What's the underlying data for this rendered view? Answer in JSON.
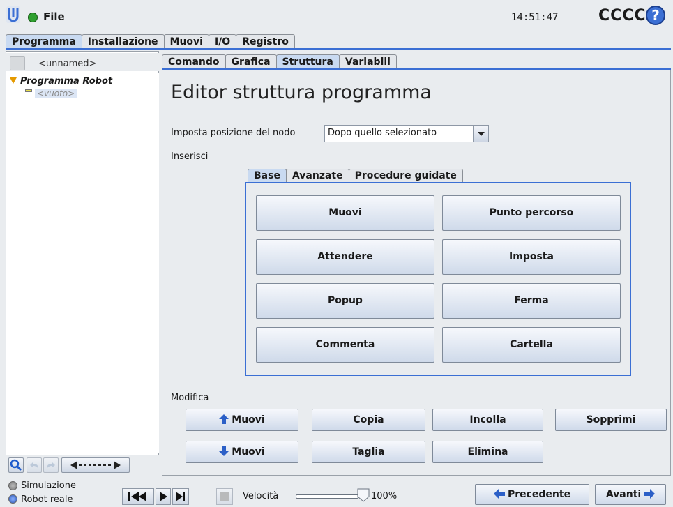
{
  "header": {
    "file_label": "File",
    "clock": "14:51:47",
    "robot_name": "CCCC",
    "help_glyph": "?"
  },
  "main_tabs": [
    {
      "label": "Programma",
      "active": true
    },
    {
      "label": "Installazione",
      "active": false
    },
    {
      "label": "Muovi",
      "active": false
    },
    {
      "label": "I/O",
      "active": false
    },
    {
      "label": "Registro",
      "active": false
    }
  ],
  "tree": {
    "program_name": "<unnamed>",
    "root_label": "Programma Robot",
    "child_label": "<vuoto>"
  },
  "sub_tabs": [
    {
      "label": "Comando",
      "active": false
    },
    {
      "label": "Grafica",
      "active": false
    },
    {
      "label": "Struttura",
      "active": true
    },
    {
      "label": "Variabili",
      "active": false
    }
  ],
  "editor": {
    "title": "Editor struttura programma",
    "position_label": "Imposta posizione del nodo",
    "position_value": "Dopo quello selezionato",
    "insert_label": "Inserisci",
    "modify_label": "Modifica"
  },
  "insert_tabs": [
    {
      "label": "Base",
      "active": true
    },
    {
      "label": "Avanzate",
      "active": false
    },
    {
      "label": "Procedure guidate",
      "active": false
    }
  ],
  "insert_buttons": [
    "Muovi",
    "Punto percorso",
    "Attendere",
    "Imposta",
    "Popup",
    "Ferma",
    "Commenta",
    "Cartella"
  ],
  "modify_buttons": {
    "move_up": "Muovi",
    "copy": "Copia",
    "paste": "Incolla",
    "delete": "Sopprimi",
    "move_down": "Muovi",
    "cut": "Taglia",
    "remove": "Elimina"
  },
  "bottom": {
    "simulation_label": "Simulazione",
    "real_robot_label": "Robot reale",
    "speed_label": "Velocità",
    "speed_value": "100%",
    "speed_fraction": 1.0,
    "prev_label": "Precedente",
    "next_label": "Avanti"
  },
  "colors": {
    "accent": "#3b6fd4",
    "active_tab": "#c9daf1",
    "status_ok": "#2fa02f"
  }
}
